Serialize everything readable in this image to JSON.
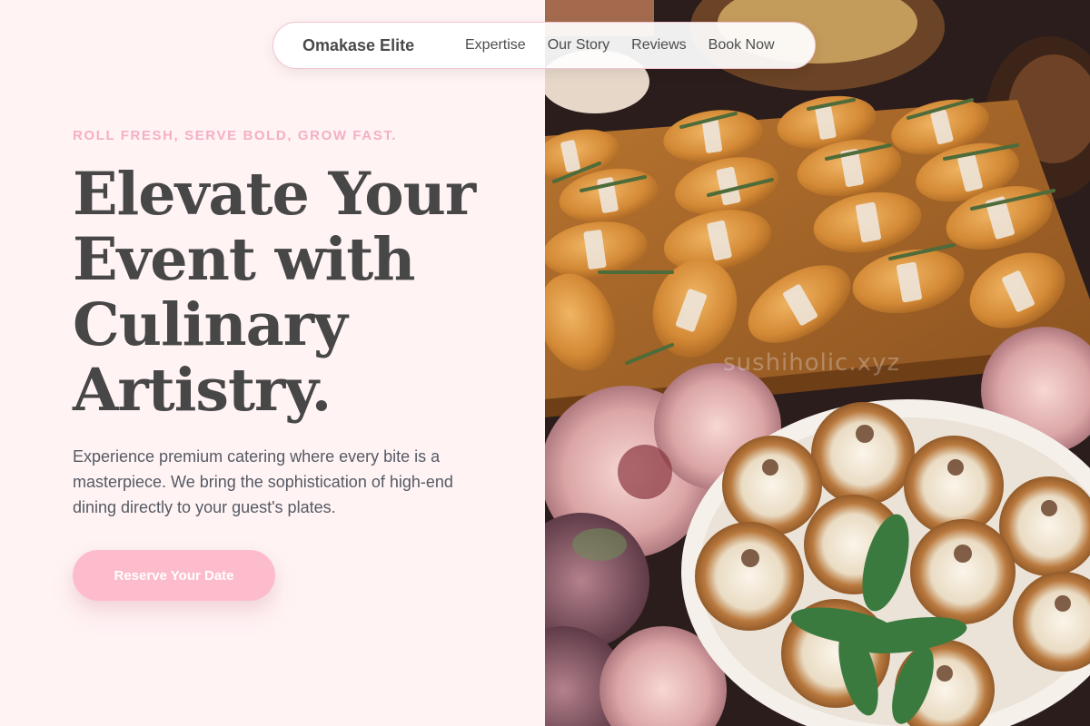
{
  "nav": {
    "brand": "Omakase Elite",
    "links": [
      "Expertise",
      "Our Story",
      "Reviews",
      "Book Now"
    ]
  },
  "hero": {
    "tagline": "ROLL FRESH, SERVE BOLD, GROW FAST.",
    "headline_lines": [
      "Elevate Your",
      "Event with",
      "Culinary",
      "Artistry."
    ],
    "description": "Experience premium catering where every bite is a masterpiece. We bring the sophistication of high-end dining directly to your guest's plates.",
    "cta_label": "Reserve Your Date"
  },
  "photo": {
    "watermark": "sushiholic.xyz"
  },
  "colors": {
    "background": "#fff3f4",
    "accent_pink": "#fdbccb",
    "tagline_pink": "#f5afc4",
    "heading": "#474747"
  }
}
